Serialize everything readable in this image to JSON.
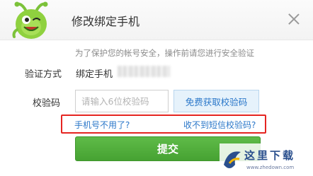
{
  "dialog": {
    "title": "修改绑定手机",
    "mascot_icon": "green-monster-icon",
    "close_icon": "close-icon"
  },
  "form": {
    "notice": "为了保护您的帐号安全，操作前请您进行安全验证",
    "method_label": "验证方式",
    "method_value": "绑定手机",
    "code_label": "校验码",
    "code_placeholder": "请输入6位校验码",
    "code_value": "",
    "get_code_button": "免费获取校验码"
  },
  "links": {
    "phone_unused": "手机号不用了?",
    "no_sms": "收不到短信校验码?"
  },
  "submit_button": "提交",
  "watermark": {
    "text": "这里下载",
    "url": "www.zhedown.com"
  },
  "colors": {
    "accent_blue": "#2a77c9",
    "submit_green": "#4fae3b",
    "highlight_red": "#e52521"
  }
}
